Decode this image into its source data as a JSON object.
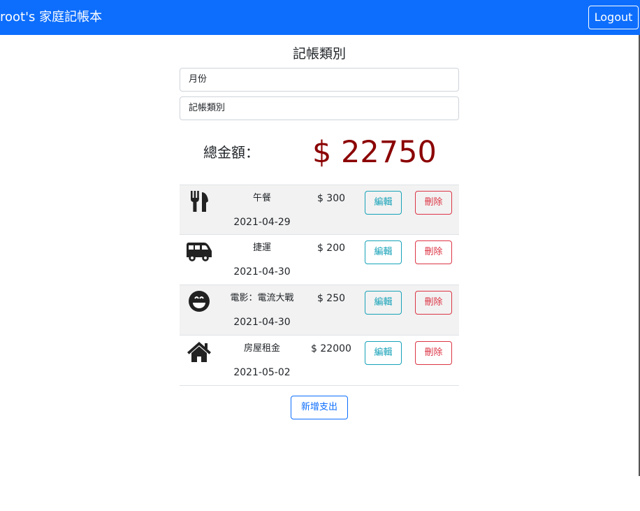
{
  "navbar": {
    "brand": "root's 家庭記帳本",
    "logout_label": "Logout"
  },
  "page": {
    "title": "記帳類別"
  },
  "filters": {
    "month_value": "月份",
    "category_value": "記帳類別"
  },
  "total": {
    "label": "總金額：",
    "amount": "$ 22750"
  },
  "records": [
    {
      "icon": "utensils-icon",
      "name": "午餐",
      "amount": "$ 300",
      "date": "2021-04-29",
      "edit_label": "編輯",
      "delete_label": "刪除"
    },
    {
      "icon": "shuttle-van-icon",
      "name": "捷運",
      "amount": "$ 200",
      "date": "2021-04-30",
      "edit_label": "編輯",
      "delete_label": "刪除"
    },
    {
      "icon": "grin-icon",
      "name": "電影：電流大戰",
      "amount": "$ 250",
      "date": "2021-04-30",
      "edit_label": "編輯",
      "delete_label": "刪除"
    },
    {
      "icon": "home-icon",
      "name": "房屋租金",
      "amount": "$ 22000",
      "date": "2021-05-02",
      "edit_label": "編輯",
      "delete_label": "刪除"
    }
  ],
  "actions": {
    "add_label": "新增支出"
  },
  "colors": {
    "navbar": "#0d6efd",
    "total_amount": "#8b0000",
    "edit": "#17a2b8",
    "delete": "#dc3545"
  }
}
